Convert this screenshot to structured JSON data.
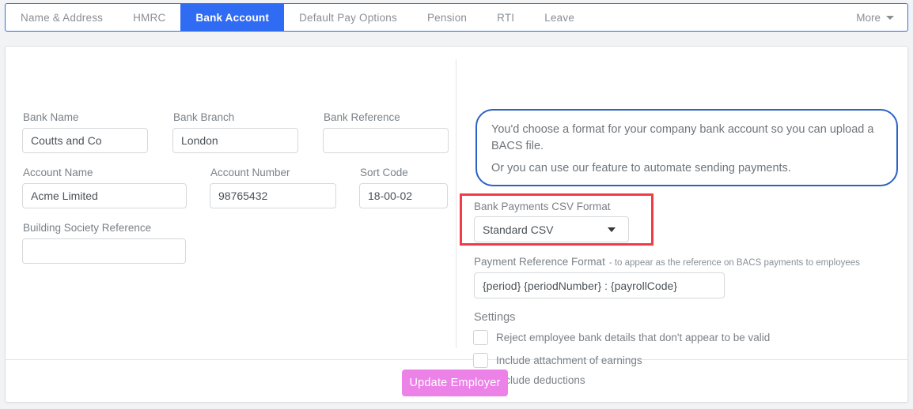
{
  "tabs": {
    "items": [
      {
        "label": "Name & Address",
        "active": false
      },
      {
        "label": "HMRC",
        "active": false
      },
      {
        "label": "Bank Account",
        "active": true
      },
      {
        "label": "Default Pay Options",
        "active": false
      },
      {
        "label": "Pension",
        "active": false
      },
      {
        "label": "RTI",
        "active": false
      },
      {
        "label": "Leave",
        "active": false
      }
    ],
    "more_label": "More"
  },
  "bank_details": {
    "bank_name": {
      "label": "Bank Name",
      "value": "Coutts and Co",
      "placeholder": ""
    },
    "bank_branch": {
      "label": "Bank Branch",
      "value": "London",
      "placeholder": ""
    },
    "bank_reference": {
      "label": "Bank Reference",
      "value": "",
      "placeholder": ""
    },
    "account_name": {
      "label": "Account Name",
      "value": "Acme Limited",
      "placeholder": ""
    },
    "account_number": {
      "label": "Account Number",
      "value": "98765432",
      "placeholder": ""
    },
    "sort_code": {
      "label": "Sort Code",
      "value": "18-00-02",
      "placeholder": ""
    },
    "building_society_reference": {
      "label": "Building Society Reference",
      "value": "",
      "placeholder": ""
    }
  },
  "info_box": {
    "line1": "You'd choose a format for your company bank account so you can upload a BACS file.",
    "line2": "Or you can use our feature to automate sending payments.",
    "border_color": "#2a62c4"
  },
  "payments": {
    "csv_format": {
      "label": "Bank Payments CSV Format",
      "selected": "Standard CSV",
      "highlight_color": "#f23b46"
    },
    "payment_reference": {
      "label": "Payment Reference Format",
      "sublabel": "- to appear as the reference on BACS payments to employees",
      "value": "{period} {periodNumber} : {payrollCode}",
      "placeholder": ""
    },
    "settings": {
      "title": "Settings",
      "options": [
        {
          "label": "Reject employee bank details that don't appear to be valid",
          "checked": false
        },
        {
          "label": "Include attachment of earnings",
          "checked": false
        },
        {
          "label": "Include deductions",
          "checked": false
        }
      ]
    }
  },
  "footer": {
    "submit_label": "Update Employer",
    "submit_color": "#ec82e8"
  }
}
